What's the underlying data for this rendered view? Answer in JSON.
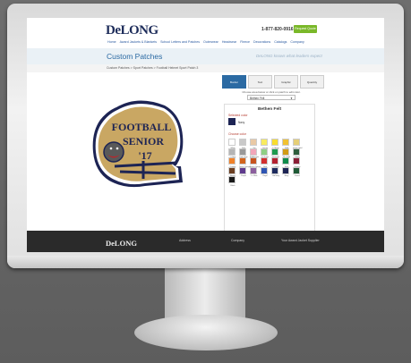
{
  "header": {
    "logo": "DeLONG",
    "phone": "1-877-820-0916",
    "quote_button": "Request Quote",
    "nav": [
      "Home",
      "Award Jackets & Blankets",
      "School Letters and Patches",
      "Outerwear",
      "Headwear",
      "Fleece",
      "Decorations",
      "Catalogs",
      "Company"
    ]
  },
  "banner": {
    "title": "Custom Patches",
    "tagline": "DeLONG knows what leaders expect"
  },
  "breadcrumb": "Custom Patches  >  Sport Patches  >  Football Helmet Sport Patch 3",
  "patch": {
    "line1": "FOOTBALL",
    "line2": "SENIOR",
    "year": "'17",
    "colors": {
      "body": "#c9a763",
      "navy": "#1d2454",
      "white": "#ffffff",
      "red": "#b8262b"
    }
  },
  "panel": {
    "tabs": [
      "Border",
      "Text",
      "Graphic",
      "Quantity"
    ],
    "hint": "Choose area below or click on patch to edit color.",
    "select_value": "Bethen Felt",
    "fabric_name": "Bethen Felt",
    "selected_label": "Selected color",
    "selected_color": {
      "name": "Navy",
      "hex": "#1d2454"
    },
    "choose_label": "Choose color",
    "colors": [
      {
        "name": "White",
        "hex": "#ffffff"
      },
      {
        "name": "Gray",
        "hex": "#c9c9c9"
      },
      {
        "name": "Tan",
        "hex": "#e9c9a5"
      },
      {
        "name": "Lemon",
        "hex": "#f8eb5f"
      },
      {
        "name": "It. Maize",
        "hex": "#f8dd2e"
      },
      {
        "name": "Gold",
        "hex": "#f1c232"
      },
      {
        "name": "Vegas Gold",
        "hex": "#e6cf77"
      },
      {
        "name": "Lt Gray",
        "hex": "#b5b5b5"
      },
      {
        "name": "Dark Gray",
        "hex": "#999999"
      },
      {
        "name": "Bubblegum",
        "hex": "#f2a6b9"
      },
      {
        "name": "Lt. Green",
        "hex": "#8fcf84"
      },
      {
        "name": "Emerald",
        "hex": "#1e9a4e"
      },
      {
        "name": "Dk. Gold",
        "hex": "#d19b15"
      },
      {
        "name": "Black",
        "hex": "#2f5e3d"
      },
      {
        "name": "Orange",
        "hex": "#f0822a"
      },
      {
        "name": "Texas Orange",
        "hex": "#d2641c"
      },
      {
        "name": "Burnt Orange",
        "hex": "#c7531e"
      },
      {
        "name": "Red",
        "hex": "#d32e2e"
      },
      {
        "name": "Cardinal",
        "hex": "#b3202f"
      },
      {
        "name": "Kelly",
        "hex": "#0f8a4a"
      },
      {
        "name": "Maroon",
        "hex": "#8a1f36"
      },
      {
        "name": "Brown",
        "hex": "#6b3f22"
      },
      {
        "name": "Purple",
        "hex": "#5f3a8d"
      },
      {
        "name": "Lt. Blue",
        "hex": "#8c5f9e"
      },
      {
        "name": "Royal",
        "hex": "#2f55b3"
      },
      {
        "name": "Old Navy",
        "hex": "#1d2a5e"
      },
      {
        "name": "Navy",
        "hex": "#1d2454"
      },
      {
        "name": "Forest",
        "hex": "#1f5a36"
      },
      {
        "name": "Black",
        "hex": "#1a1a1a"
      }
    ]
  },
  "footer": {
    "logo": "DeLONG",
    "links": [
      "Address",
      "Company",
      "Your Award Jacket Supplier"
    ]
  }
}
